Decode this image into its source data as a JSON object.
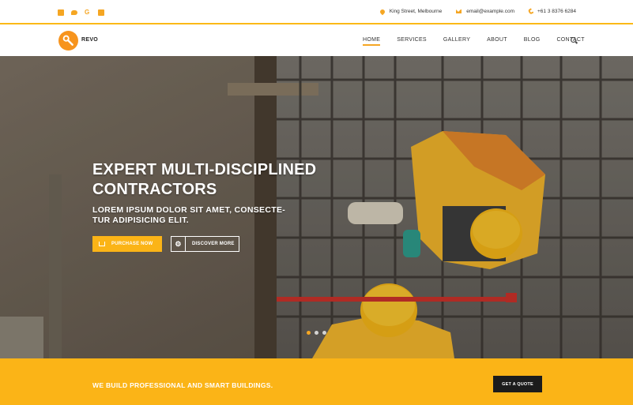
{
  "topbar": {
    "social": [
      "facebook-icon",
      "twitter-icon",
      "google-plus-icon",
      "linkedin-icon"
    ],
    "google_glyph": "G",
    "address": "King Street, Melbourne",
    "email": "email@example.com",
    "phone": "+61 3 8376 6284"
  },
  "header": {
    "brand": "REVO",
    "nav": [
      "HOME",
      "SERVICES",
      "GALLERY",
      "ABOUT",
      "BLOG",
      "CONTACT"
    ],
    "active_index": 0
  },
  "hero": {
    "title": "EXPERT MULTI-DISCIPLINED CONTRACTORS",
    "subtitle": "LOREM IPSUM DOLOR SIT AMET, CONSECTE-TUR ADIPISICING ELIT.",
    "purchase_label": "PURCHASE NOW",
    "discover_label": "DISCOVER MORE",
    "slides": 3,
    "active_slide": 0
  },
  "cta": {
    "text": "WE BUILD PROFESSIONAL AND SMART BUILDINGS.",
    "button": "GET A QUOTE"
  },
  "colors": {
    "accent": "#fbb417",
    "dark": "#1c1c1c",
    "logo": "#f7941d"
  }
}
